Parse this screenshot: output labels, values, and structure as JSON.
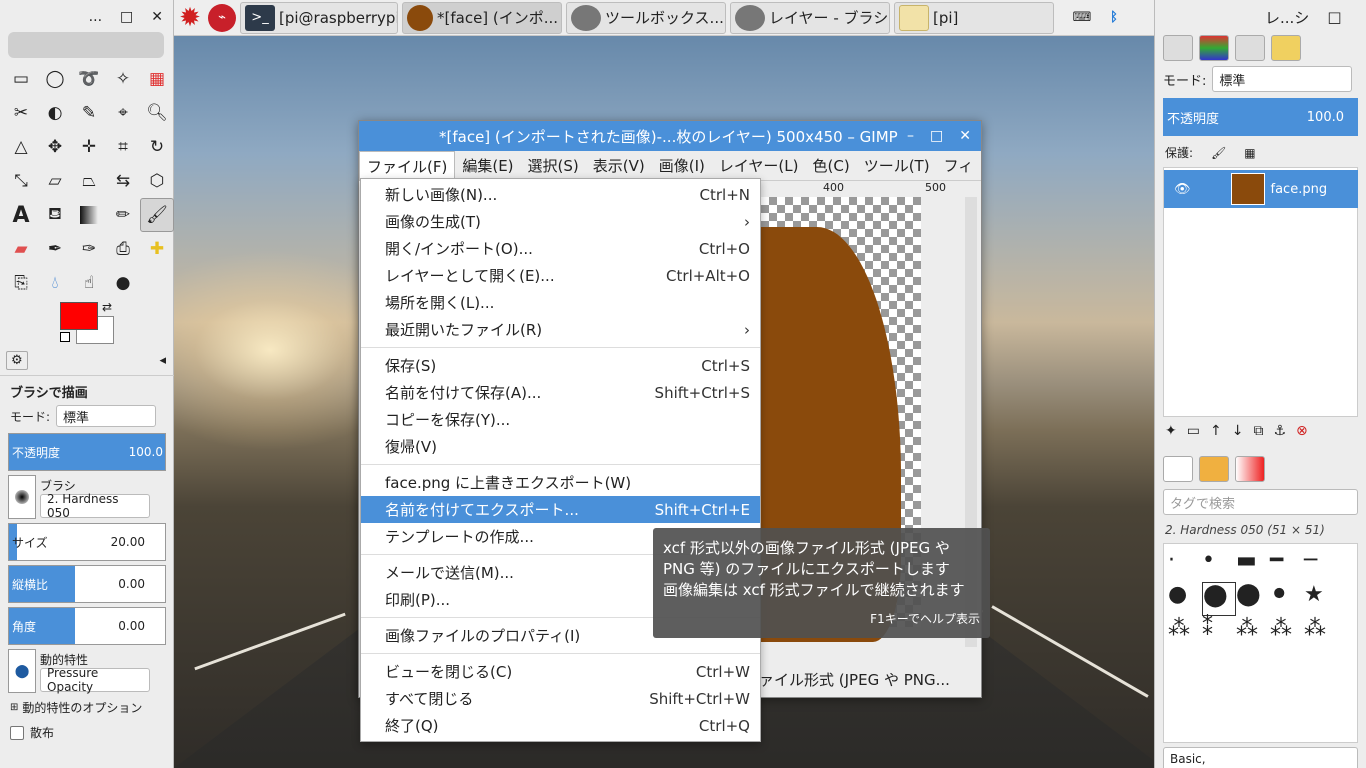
{
  "taskbar": {
    "buttons": [
      {
        "label": "[pi@raspberrypi:...",
        "icon": "terminal-icon"
      },
      {
        "label": "*[face] (インポ...",
        "icon": "face-icon"
      },
      {
        "label": "ツールボックス...",
        "icon": "gimp-icon"
      },
      {
        "label": "レイヤー - ブラシ",
        "icon": "gimp-icon"
      },
      {
        "label": "[pi]",
        "icon": "folder-icon"
      }
    ]
  },
  "toolbox": {
    "title_controls": [
      "...",
      "□",
      "✕"
    ],
    "tool_options": {
      "title": "ブラシで描画",
      "mode_label": "モード:",
      "mode_value": "標準",
      "opacity_label": "不透明度",
      "opacity_value": "100.0",
      "brush_label": "ブラシ",
      "brush_value": "2. Hardness 050",
      "size_label": "サイズ",
      "size_value": "20.00",
      "aspect_label": "縦横比",
      "aspect_value": "0.00",
      "angle_label": "角度",
      "angle_value": "0.00",
      "dynamics_label": "動的特性",
      "dynamics_value": "Pressure Opacity",
      "dynamics_options": "動的特性のオプション",
      "scatter": "散布"
    }
  },
  "image_window": {
    "title": "*[face] (インポートされた画像)-...枚のレイヤー) 500x450 – GIMP",
    "menu": [
      "ファイル(F)",
      "編集(E)",
      "選択(S)",
      "表示(V)",
      "画像(I)",
      "レイヤー(L)",
      "色(C)",
      "ツール(T)",
      "フィ"
    ],
    "ruler": [
      "400",
      "500"
    ],
    "status": "ァイル形式 (JPEG や PNG..."
  },
  "file_menu": [
    {
      "label": "新しい画像(N)...",
      "acc": "Ctrl+N"
    },
    {
      "label": "画像の生成(T)",
      "acc": "›"
    },
    {
      "label": "開く/インポート(O)...",
      "acc": "Ctrl+O"
    },
    {
      "label": "レイヤーとして開く(E)...",
      "acc": "Ctrl+Alt+O"
    },
    {
      "label": "場所を開く(L)...",
      "acc": ""
    },
    {
      "label": "最近開いたファイル(R)",
      "acc": "›"
    },
    {
      "sep": true
    },
    {
      "label": "保存(S)",
      "acc": "Ctrl+S"
    },
    {
      "label": "名前を付けて保存(A)...",
      "acc": "Shift+Ctrl+S"
    },
    {
      "label": "コピーを保存(Y)...",
      "acc": ""
    },
    {
      "label": "復帰(V)",
      "acc": ""
    },
    {
      "sep": true
    },
    {
      "label": "face.png に上書きエクスポート(W)",
      "acc": ""
    },
    {
      "label": "名前を付けてエクスポート...",
      "acc": "Shift+Ctrl+E",
      "highlighted": true
    },
    {
      "label": "テンプレートの作成...",
      "acc": ""
    },
    {
      "sep": true
    },
    {
      "label": "メールで送信(M)...",
      "acc": ""
    },
    {
      "label": "印刷(P)...",
      "acc": ""
    },
    {
      "sep": true
    },
    {
      "label": "画像ファイルのプロパティ(I)",
      "acc": ""
    },
    {
      "sep": true
    },
    {
      "label": "ビューを閉じる(C)",
      "acc": "Ctrl+W"
    },
    {
      "label": "すべて閉じる",
      "acc": "Shift+Ctrl+W"
    },
    {
      "label": "終了(Q)",
      "acc": "Ctrl+Q"
    }
  ],
  "tooltip": {
    "line1": "xcf 形式以外の画像ファイル形式 (JPEG や",
    "line2": "PNG 等) のファイルにエクスポートします",
    "line3": "画像編集は xcf 形式ファイルで継続されます",
    "help": "F1キーでヘルプ表示"
  },
  "dock": {
    "title": "レ...シ",
    "mode_label": "モード:",
    "mode_value": "標準",
    "opacity_label": "不透明度",
    "opacity_value": "100.0",
    "lock_label": "保護:",
    "layer_name": "face.png",
    "tag_placeholder": "タグで検索",
    "brush_info": "2. Hardness 050 (51 × 51)",
    "brush_set": "Basic,"
  }
}
